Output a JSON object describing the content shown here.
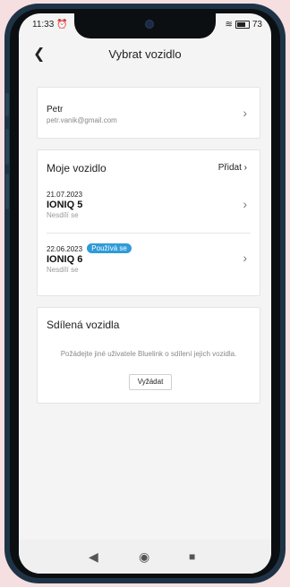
{
  "status_bar": {
    "time": "11:33",
    "battery": "73"
  },
  "header": {
    "title": "Vybrat vozidlo"
  },
  "account": {
    "name": "Petr",
    "email": "petr.vanik@gmail.com"
  },
  "my_vehicles": {
    "title": "Moje vozidlo",
    "add_label": "Přidat",
    "vehicles": [
      {
        "date": "21.07.2023",
        "model": "IONIQ 5",
        "share": "Nesdílí se",
        "badge": ""
      },
      {
        "date": "22.06.2023",
        "model": "IONIQ 6",
        "share": "Nesdílí se",
        "badge": "Používá se"
      }
    ]
  },
  "shared_vehicles": {
    "title": "Sdílená vozidla",
    "info": "Požádejte jiné uživatele Bluelink o sdílení jejich vozidla.",
    "request_label": "Vyžádat"
  },
  "colors": {
    "accent": "#2f9bd8",
    "phone_frame": "#1e3446",
    "background": "#f6dfe0"
  }
}
